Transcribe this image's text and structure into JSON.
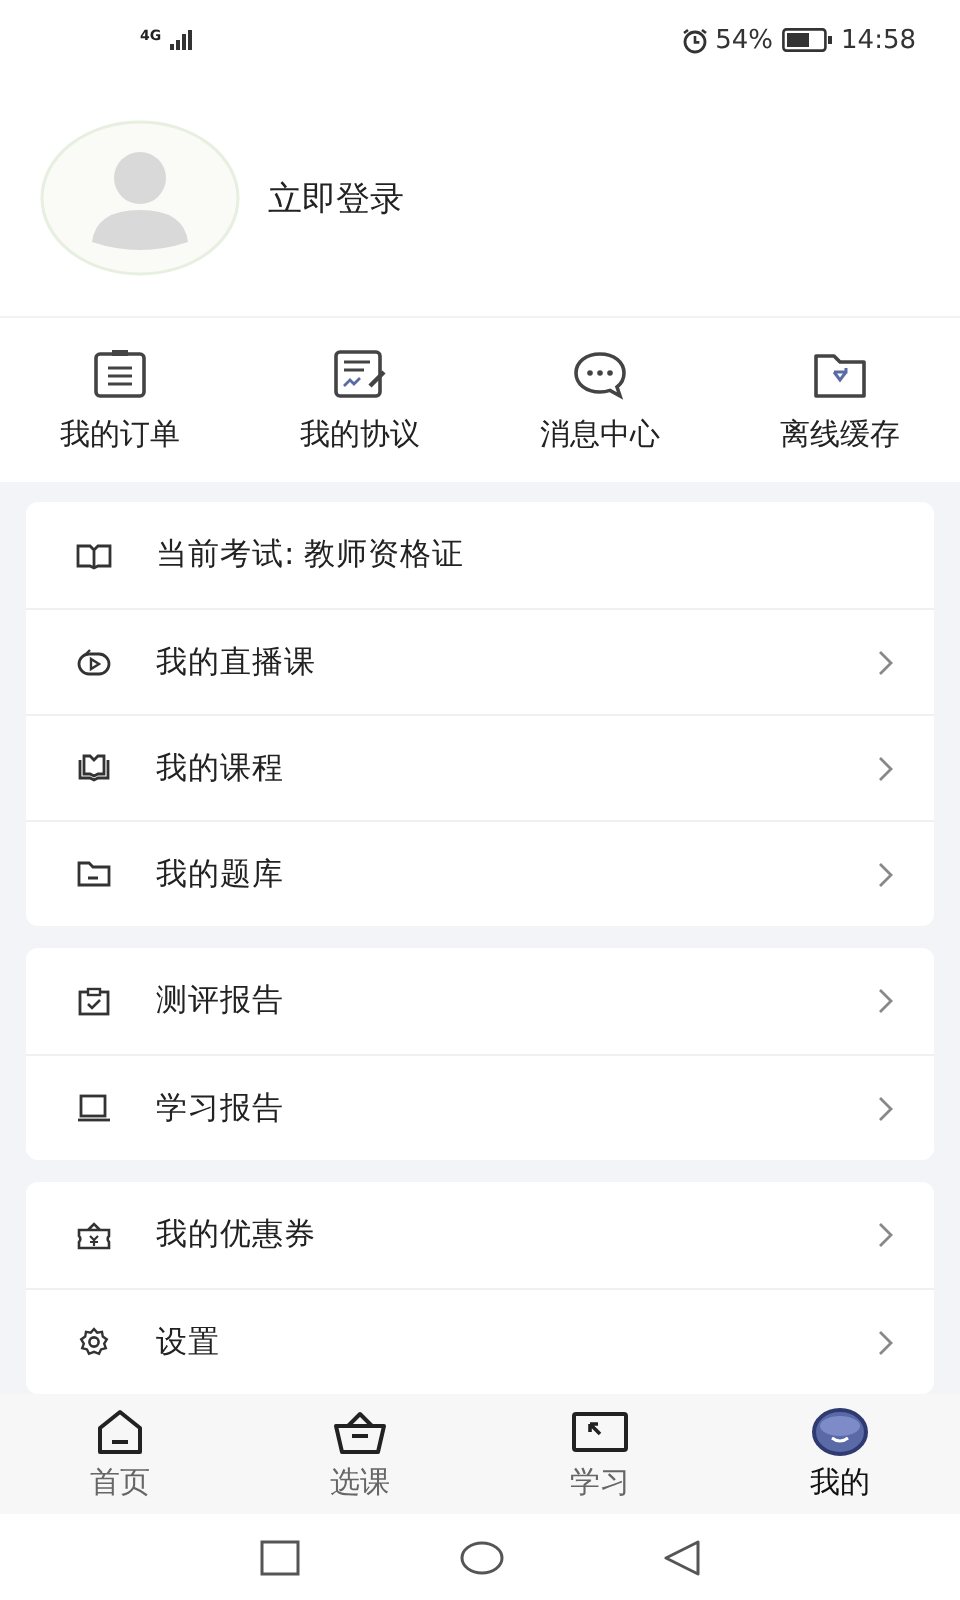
{
  "status_bar": {
    "network": "4G",
    "battery": "54%",
    "time": "14:58"
  },
  "profile": {
    "login": "立即登录"
  },
  "quick_actions": [
    {
      "label": "我的订单"
    },
    {
      "label": "我的协议"
    },
    {
      "label": "消息中心"
    },
    {
      "label": "离线缓存"
    }
  ],
  "menu_groups": [
    {
      "items": [
        {
          "label": "当前考试: 教师资格证",
          "has_arrow": false
        },
        {
          "label": "我的直播课",
          "has_arrow": true
        },
        {
          "label": "我的课程",
          "has_arrow": true
        },
        {
          "label": "我的题库",
          "has_arrow": true
        }
      ]
    },
    {
      "items": [
        {
          "label": "测评报告",
          "has_arrow": true
        },
        {
          "label": "学习报告",
          "has_arrow": true
        }
      ]
    },
    {
      "items": [
        {
          "label": "我的优惠券",
          "has_arrow": true
        },
        {
          "label": "设置",
          "has_arrow": true
        }
      ]
    }
  ],
  "tab_bar": [
    {
      "label": "首页",
      "selected": false
    },
    {
      "label": "选课",
      "selected": false
    },
    {
      "label": "学习",
      "selected": false
    },
    {
      "label": "我的",
      "selected": true
    }
  ]
}
